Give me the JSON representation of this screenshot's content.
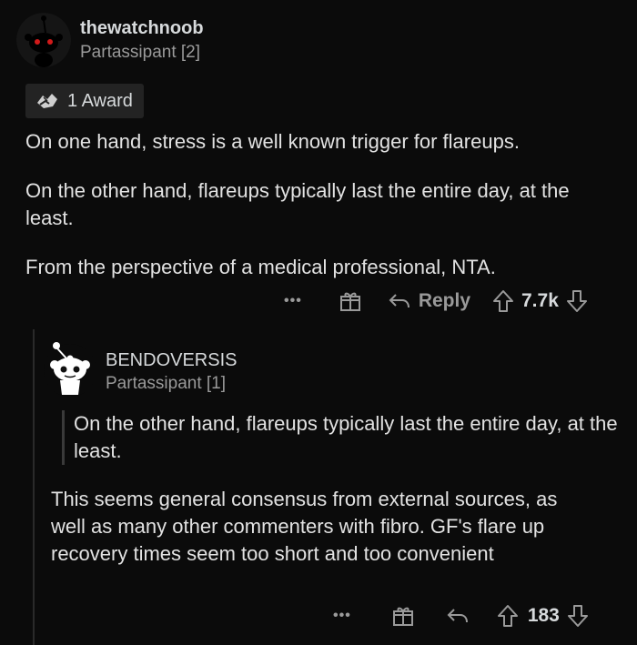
{
  "comment1": {
    "username": "thewatchnoob",
    "flair": "Partassipant [2]",
    "award_label": "1 Award",
    "paragraphs": [
      "On one hand, stress is a well known trigger for flareups.",
      "On the other hand, flareups typically last the entire day, at the least.",
      "From the perspective of a medical professional, NTA."
    ],
    "actions": {
      "more": "•••",
      "reply": "Reply",
      "score": "7.7k"
    }
  },
  "comment2": {
    "username": "BENDOVERSIS",
    "flair": "Partassipant [1]",
    "quote": "On the other hand, flareups typically last the entire day, at the least.",
    "body": "This seems general consensus from external sources, as well as many other commenters with fibro. GF's flare up recovery times seem too short and too convenient",
    "actions": {
      "more": "•••",
      "score": "183"
    }
  },
  "colors": {
    "background": "#0b0b0b",
    "text": "#e2e2e2",
    "muted": "#9a9a9a",
    "award_bg": "#232323"
  },
  "icons": [
    "avatar-dark",
    "award-hands-icon",
    "gift-icon",
    "reply-arrow-icon",
    "upvote-icon",
    "downvote-icon",
    "snoo-avatar"
  ]
}
